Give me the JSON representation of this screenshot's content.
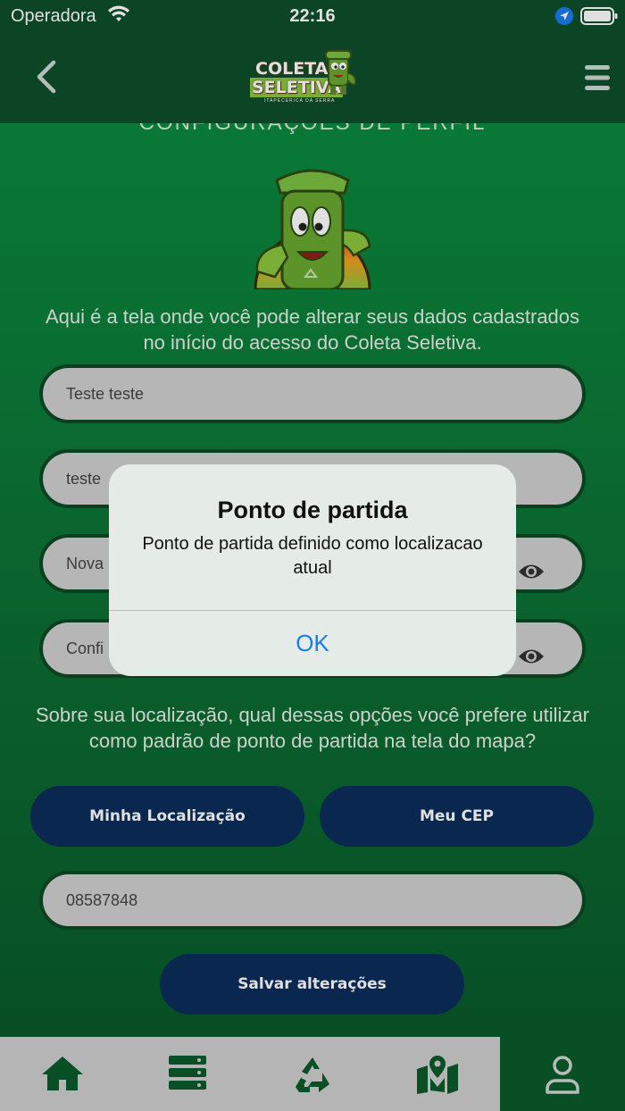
{
  "status_bar": {
    "carrier": "Operadora",
    "time": "22:16"
  },
  "nav": {
    "logo_line1": "COLETA",
    "logo_line2": "SELETIVA",
    "logo_sub": "ITAPECERICA DA SERRA"
  },
  "page": {
    "cut_title": "CONFIGURAÇÕES DE PERFIL",
    "intro": "Aqui é a tela onde você pode alterar seus dados cadastrados no início do acesso do Coleta Seletiva."
  },
  "form": {
    "name_value": "Teste teste",
    "email_value": "teste",
    "new_password_placeholder": "Nova",
    "confirm_password_placeholder": "Confi",
    "location_question": "Sobre sua localização, qual dessas opções você prefere utilizar como padrão de ponto de partida na tela do mapa?",
    "my_location_label": "Minha Localização",
    "my_cep_label": "Meu CEP",
    "cep_value": "08587848",
    "save_label": "Salvar alterações"
  },
  "dialog": {
    "title": "Ponto de partida",
    "message": "Ponto de partida definido como localizacao atual",
    "ok_label": "OK"
  },
  "tabbar": {
    "items": [
      "home-icon",
      "list-icon",
      "recycle-icon",
      "map-icon",
      "profile-icon"
    ],
    "active_index": 4
  },
  "colors": {
    "primary_green": "#0e4f2b",
    "button_blue": "#0b2d5a",
    "link_blue": "#1a7cf0"
  }
}
